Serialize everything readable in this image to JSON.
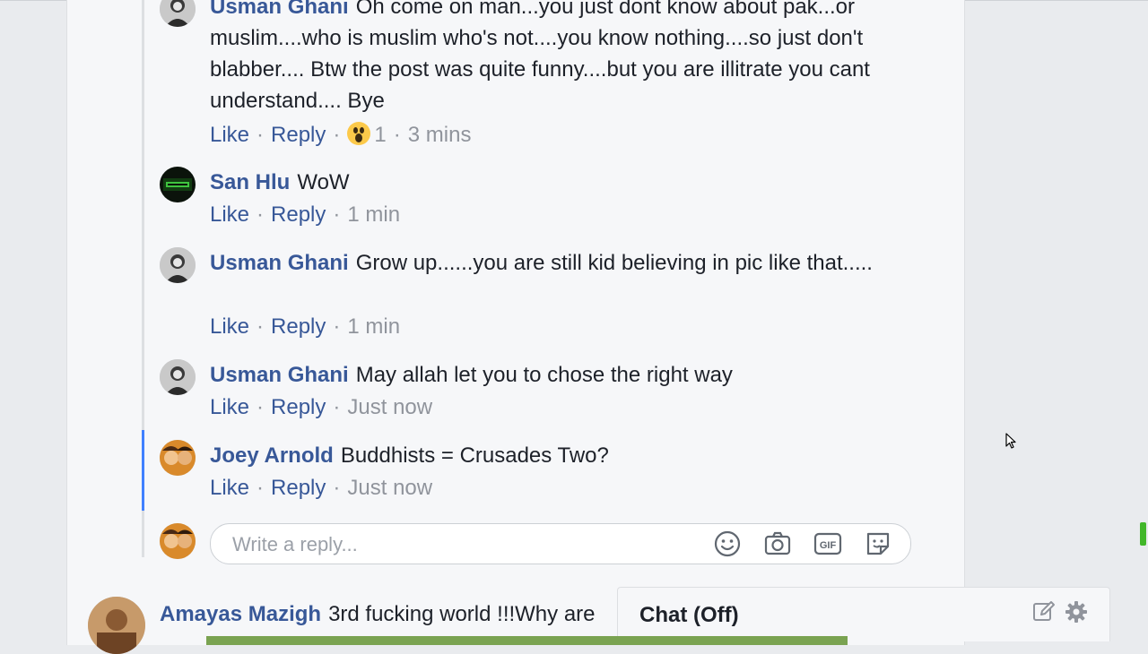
{
  "comments": [
    {
      "author": "Usman Ghani",
      "text": "Oh come on man...you just dont know about pak...or muslim....who is muslim who's not....you know nothing....so just don't blabber.... Btw the post was quite funny....but you are illitrate you cant understand.... Bye",
      "like": "Like",
      "reply": "Reply",
      "reaction_count": "1",
      "reaction_icon": "wow-emoji",
      "time": "3 mins"
    },
    {
      "author": "San Hlu",
      "text": "WoW",
      "like": "Like",
      "reply": "Reply",
      "time": "1 min"
    },
    {
      "author": "Usman Ghani",
      "text": "Grow up......you are still kid believing in pic like that.....",
      "like": "Like",
      "reply": "Reply",
      "time": "1 min"
    },
    {
      "author": "Usman Ghani",
      "text": "May allah let you to chose the right way",
      "like": "Like",
      "reply": "Reply",
      "time": "Just now"
    },
    {
      "author": "Joey Arnold",
      "text": "Buddhists = Crusades Two?",
      "like": "Like",
      "reply": "Reply",
      "time": "Just now"
    }
  ],
  "composer": {
    "placeholder": "Write a reply...",
    "icons": [
      "emoji-icon",
      "camera-icon",
      "gif-icon",
      "sticker-icon"
    ]
  },
  "next_comment": {
    "author": "Amayas Mazigh",
    "text": "3rd fucking world !!!Why are"
  },
  "chat": {
    "title": "Chat (Off)",
    "icons": [
      "compose-icon",
      "settings-gear-icon"
    ]
  },
  "colors": {
    "link": "#385898",
    "meta": "#90949c",
    "thread_active": "#4080ff",
    "bottom_strip": "#7aa351"
  }
}
